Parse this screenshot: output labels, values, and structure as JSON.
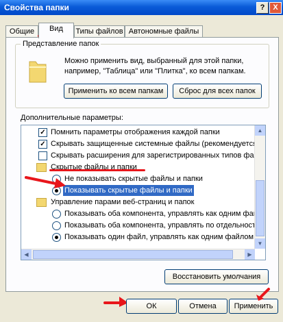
{
  "window": {
    "title": "Свойства папки",
    "help_label": "?",
    "close_label": "X"
  },
  "tabs": [
    {
      "label": "Общие"
    },
    {
      "label": "Вид"
    },
    {
      "label": "Типы файлов"
    },
    {
      "label": "Автономные файлы"
    }
  ],
  "folder_views": {
    "group_label": "Представление папок",
    "description": "Можно применить вид, выбранный для этой папки, например, \"Таблица\" или \"Плитка\", ко всем папкам.",
    "apply_all_label": "Применить ко всем папкам",
    "reset_all_label": "Сброс для всех папок"
  },
  "advanced": {
    "label": "Дополнительные параметры:",
    "items": [
      {
        "label": "Помнить параметры отображения каждой папки"
      },
      {
        "label": "Скрывать защищенные системные файлы (рекомендуется)"
      },
      {
        "label": "Скрывать расширения для зарегистрированных типов файлов"
      },
      {
        "label": "Скрытые файлы и папки"
      },
      {
        "label": "Не показывать скрытые файлы и папки"
      },
      {
        "label": "Показывать скрытые файлы и папки"
      },
      {
        "label": "Управление парами веб-страниц и папок"
      },
      {
        "label": "Показывать оба компонента, управлять как одним файлом"
      },
      {
        "label": "Показывать оба компонента, управлять по отдельности"
      },
      {
        "label": "Показывать один файл, управлять как одним файлом"
      }
    ],
    "restore_label": "Восстановить умолчания"
  },
  "footer": {
    "ok_label": "ОК",
    "cancel_label": "Отмена",
    "apply_label": "Применить"
  },
  "colors": {
    "titlebar": "#0a5bd8",
    "selection": "#316ac5",
    "annotation": "#e8161b",
    "face": "#ece9d8"
  }
}
